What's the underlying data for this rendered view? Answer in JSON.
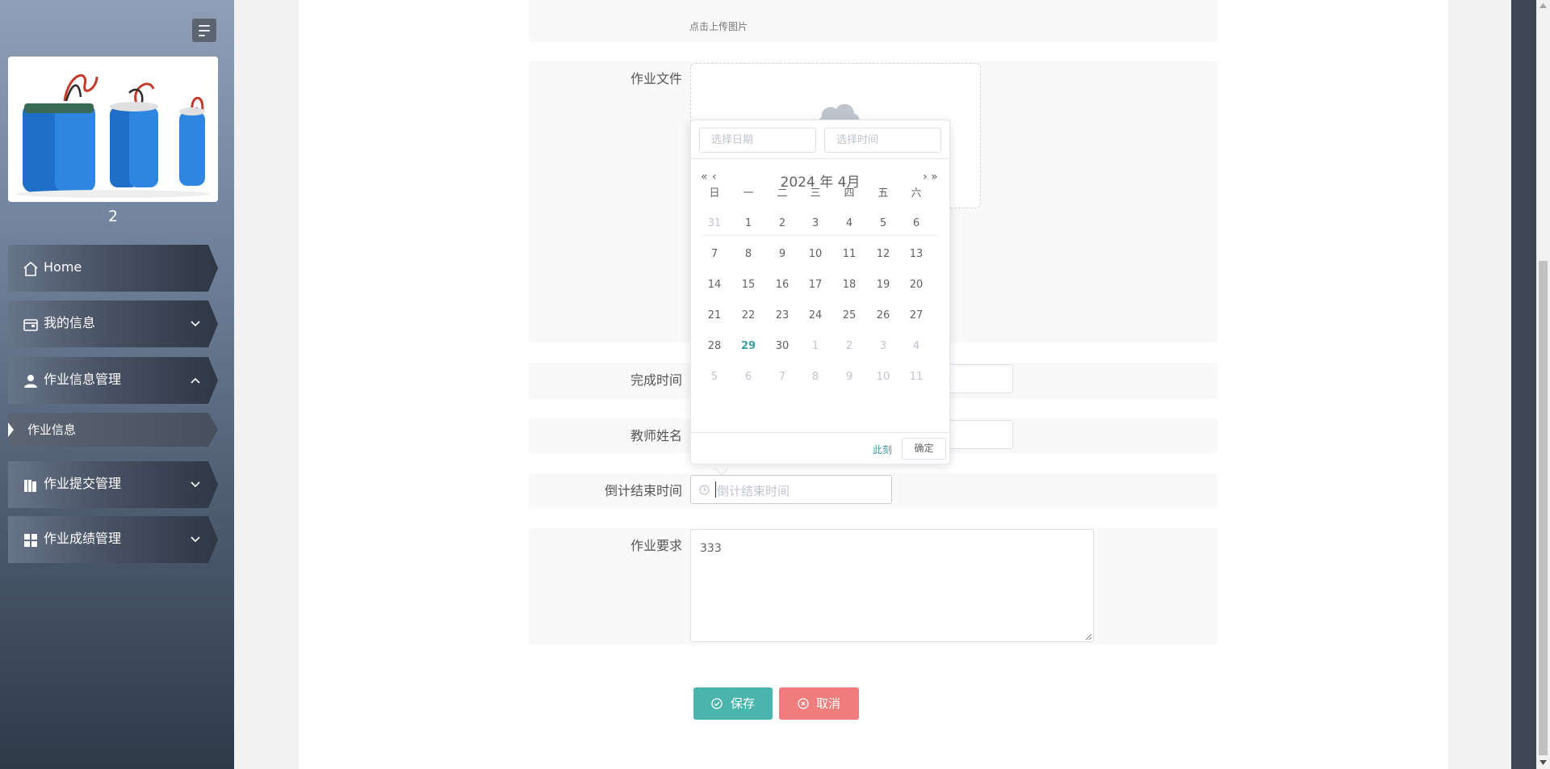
{
  "sidebar": {
    "user_name": "2",
    "menu": [
      {
        "label": "Home",
        "icon": "home-icon"
      },
      {
        "label": "我的信息",
        "icon": "wallet-icon"
      },
      {
        "label": "作业信息管理",
        "icon": "user-icon"
      },
      {
        "label": "作业提交管理",
        "icon": "books-icon"
      },
      {
        "label": "作业成绩管理",
        "icon": "grid-icon"
      }
    ],
    "submenu_active": "作业信息"
  },
  "form": {
    "upload_hint": "点击上传图片",
    "file_label": "作业文件",
    "complete_time_label": "完成时间",
    "teacher_label": "教师姓名",
    "deadline_label": "倒计结束时间",
    "deadline_placeholder": "倒计结束时间",
    "requirement_label": "作业要求",
    "requirement_value": "333",
    "save_label": "保存",
    "cancel_label": "取消"
  },
  "datepicker": {
    "date_placeholder": "选择日期",
    "time_placeholder": "选择时间",
    "year": "2024",
    "year_suffix": "年",
    "month": "4",
    "month_suffix": "月",
    "prev_year": "«",
    "prev_month": "‹",
    "next_month": "›",
    "next_year": "»",
    "weekdays": [
      "日",
      "一",
      "二",
      "三",
      "四",
      "五",
      "六"
    ],
    "weeks": [
      [
        "31",
        "1",
        "2",
        "3",
        "4",
        "5",
        "6"
      ],
      [
        "7",
        "8",
        "9",
        "10",
        "11",
        "12",
        "13"
      ],
      [
        "14",
        "15",
        "16",
        "17",
        "18",
        "19",
        "20"
      ],
      [
        "21",
        "22",
        "23",
        "24",
        "25",
        "26",
        "27"
      ],
      [
        "28",
        "29",
        "30",
        "1",
        "2",
        "3",
        "4"
      ],
      [
        "5",
        "6",
        "7",
        "8",
        "9",
        "10",
        "11"
      ]
    ],
    "today": "29",
    "now_label": "此刻",
    "confirm_label": "确定"
  },
  "colors": {
    "save_button": "#4ab5ac",
    "cancel_button": "#f07c7c",
    "today_text": "#409f9e"
  }
}
